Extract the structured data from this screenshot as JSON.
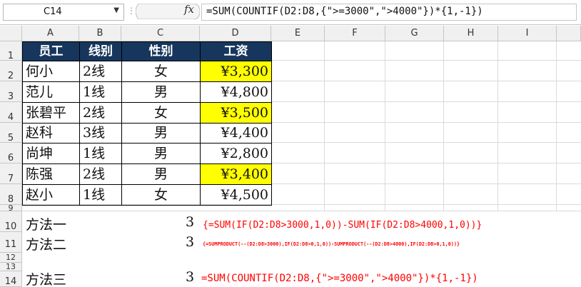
{
  "formula_bar": {
    "name_box": "C14",
    "fx_label": "fx",
    "formula": "=SUM(COUNTIF(D2:D8,{\">=3000\",\">4000\"})*{1,-1})"
  },
  "columns": [
    "A",
    "B",
    "C",
    "D",
    "E",
    "F",
    "G",
    "H",
    "I"
  ],
  "rows": [
    "1",
    "2",
    "3",
    "4",
    "5",
    "6",
    "7",
    "8",
    "9",
    "10",
    "11",
    "12",
    "13",
    "14"
  ],
  "table": {
    "headers": [
      "员工",
      "线别",
      "性别",
      "工资"
    ],
    "data": [
      {
        "name": "何小",
        "line": "2线",
        "gender": "女",
        "salary": "¥3,300",
        "highlight": true
      },
      {
        "name": "范儿",
        "line": "1线",
        "gender": "男",
        "salary": "¥4,800",
        "highlight": false
      },
      {
        "name": "张碧平",
        "line": "2线",
        "gender": "女",
        "salary": "¥3,500",
        "highlight": true
      },
      {
        "name": "赵科",
        "line": "3线",
        "gender": "男",
        "salary": "¥4,400",
        "highlight": false
      },
      {
        "name": "尚坤",
        "line": "1线",
        "gender": "男",
        "salary": "¥2,800",
        "highlight": false
      },
      {
        "name": "陈强",
        "line": "2线",
        "gender": "男",
        "salary": "¥3,400",
        "highlight": true
      },
      {
        "name": "赵小",
        "line": "1线",
        "gender": "女",
        "salary": "¥4,500",
        "highlight": false
      }
    ]
  },
  "methods": [
    {
      "label": "方法一",
      "value": "3",
      "formula": "{=SUM(IF(D2:D8>3000,1,0))-SUM(IF(D2:D8>4000,1,0))}"
    },
    {
      "label": "方法二",
      "value": "3",
      "formula": "{=SUMPRODUCT(--(D2:D8>3000),IF(D2:D8>0,1,0))-SUMPRODUCT(--(D2:D8>4000),IF(D2:D8>0,1,0))}"
    },
    {
      "label": "方法三",
      "value": "3",
      "formula": "=SUM(COUNTIF(D2:D8,{\">=3000\",\">4000\"})*{1,-1})"
    }
  ],
  "colors": {
    "header_bg": "#17365d",
    "highlight": "#ffff00",
    "note": "#ff0000"
  }
}
